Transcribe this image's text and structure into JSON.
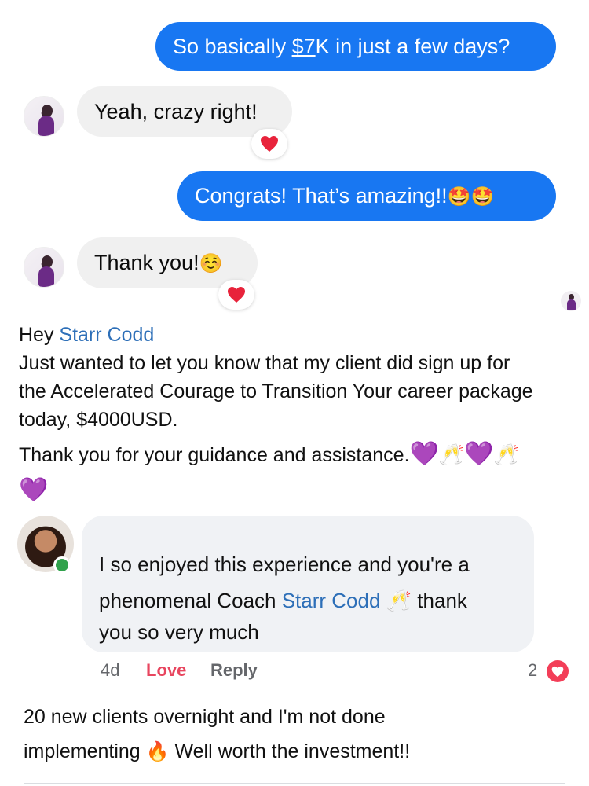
{
  "messages": [
    {
      "id": "m1",
      "direction": "outgoing",
      "pre": "So basically ",
      "underlined": "$7",
      "post": "K in just a few days?"
    },
    {
      "id": "m2",
      "direction": "incoming",
      "text": "Yeah, crazy right!",
      "reaction": "red-heart-icon"
    },
    {
      "id": "m3",
      "direction": "outgoing",
      "text": "Congrats! That’s amazing!!",
      "emoji": "🤩🤩"
    },
    {
      "id": "m4",
      "direction": "incoming",
      "text": "Thank you!",
      "emoji": "☺️",
      "reaction": "red-heart-icon"
    }
  ],
  "post": {
    "greeting": "Hey ",
    "mention": "Starr Codd",
    "line2": "Just wanted to let you know that my client did sign up for",
    "line3": "the Accelerated Courage to Transition Your career package",
    "line4": "today, $4000USD.",
    "line5": "Thank you for your guidance and assistance.",
    "emoji_hearts": "💜",
    "emoji_cheers": "🥂"
  },
  "comment": {
    "line1": "I so enjoyed this experience and you're a",
    "line2_pre": "phenomenal Coach ",
    "line2_mention": "Starr Codd",
    "line2_post": "thank",
    "line3": "you so very much",
    "emoji_cheers": "🥂",
    "time": "4d",
    "love_label": "Love",
    "reply_label": "Reply",
    "reaction_count": "2",
    "online": true
  },
  "footer_post": {
    "line1": "20 new clients overnight and I'm not done",
    "line2_pre": "implementing",
    "line2_emoji": "🔥",
    "line2_post": "Well worth the investment!!"
  },
  "colors": {
    "outgoing_bubble": "#1877f2",
    "incoming_bubble": "#f0f0f0",
    "mention": "#2d6fb8",
    "love": "#e8465f",
    "online": "#31a24c"
  }
}
